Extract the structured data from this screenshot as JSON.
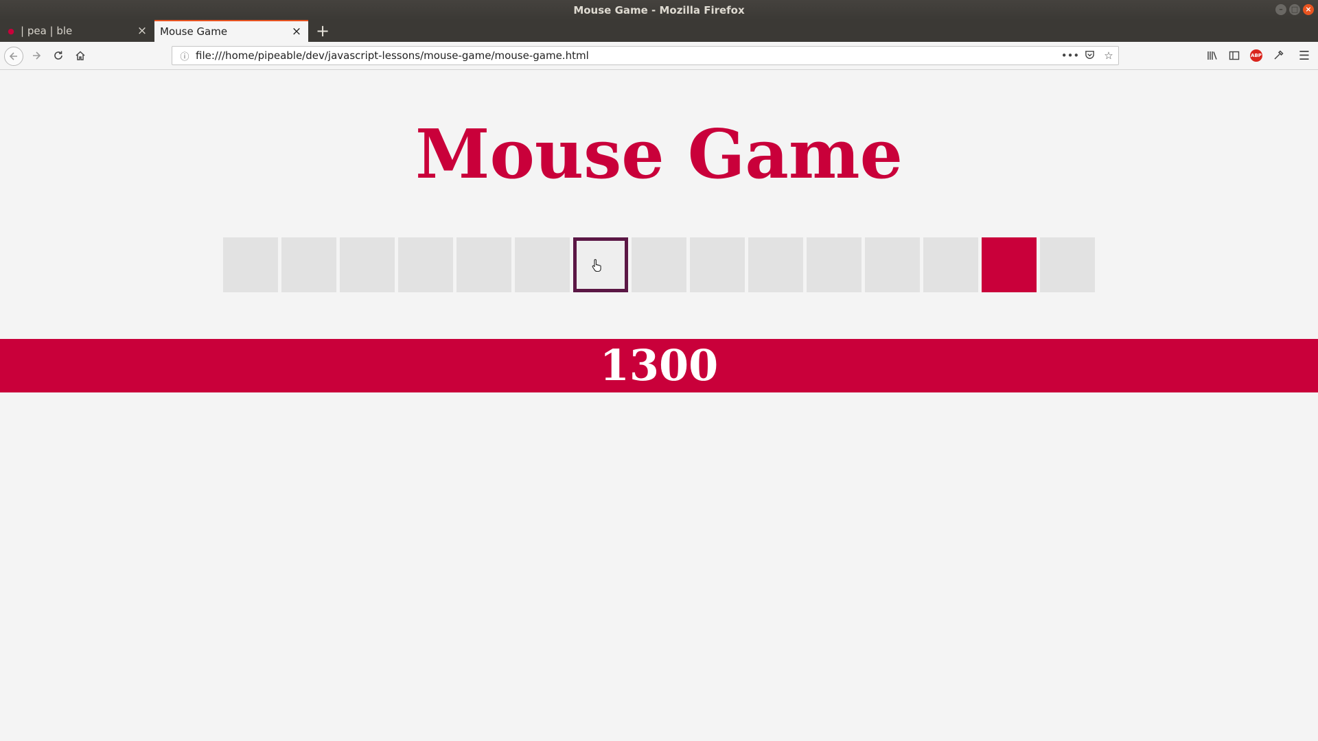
{
  "window": {
    "title": "Mouse Game - Mozilla Firefox"
  },
  "tabs": [
    {
      "label": "| pea | ble",
      "active": false
    },
    {
      "label": "Mouse Game",
      "active": true
    }
  ],
  "tab_close_glyph": "×",
  "new_tab_glyph": "+",
  "navigation": {
    "url": "file:///home/pipeable/dev/javascript-lessons/mouse-game/mouse-game.html"
  },
  "toolbar": {
    "abp_label": "ABP"
  },
  "game": {
    "title": "Mouse Game",
    "cells_count": 15,
    "hover_cell_index": 6,
    "target_cell_index": 13,
    "score": "1300"
  },
  "colors": {
    "accent": "#c9003a",
    "hover_border": "#5b1745",
    "cell": "#e2e2e2",
    "background": "#f4f4f4"
  },
  "icons": {
    "back": "arrow-left-icon",
    "forward": "arrow-right-icon",
    "reload": "reload-icon",
    "home": "home-icon",
    "info": "info-icon",
    "page_actions": "more-icon",
    "pocket": "pocket-icon",
    "bookmark": "star-icon",
    "library": "library-icon",
    "sidebar": "sidebar-icon",
    "adblock": "adblock-icon",
    "eyedropper": "eyedropper-icon",
    "menu": "hamburger-menu-icon",
    "cursor": "hand-pointer-icon"
  }
}
